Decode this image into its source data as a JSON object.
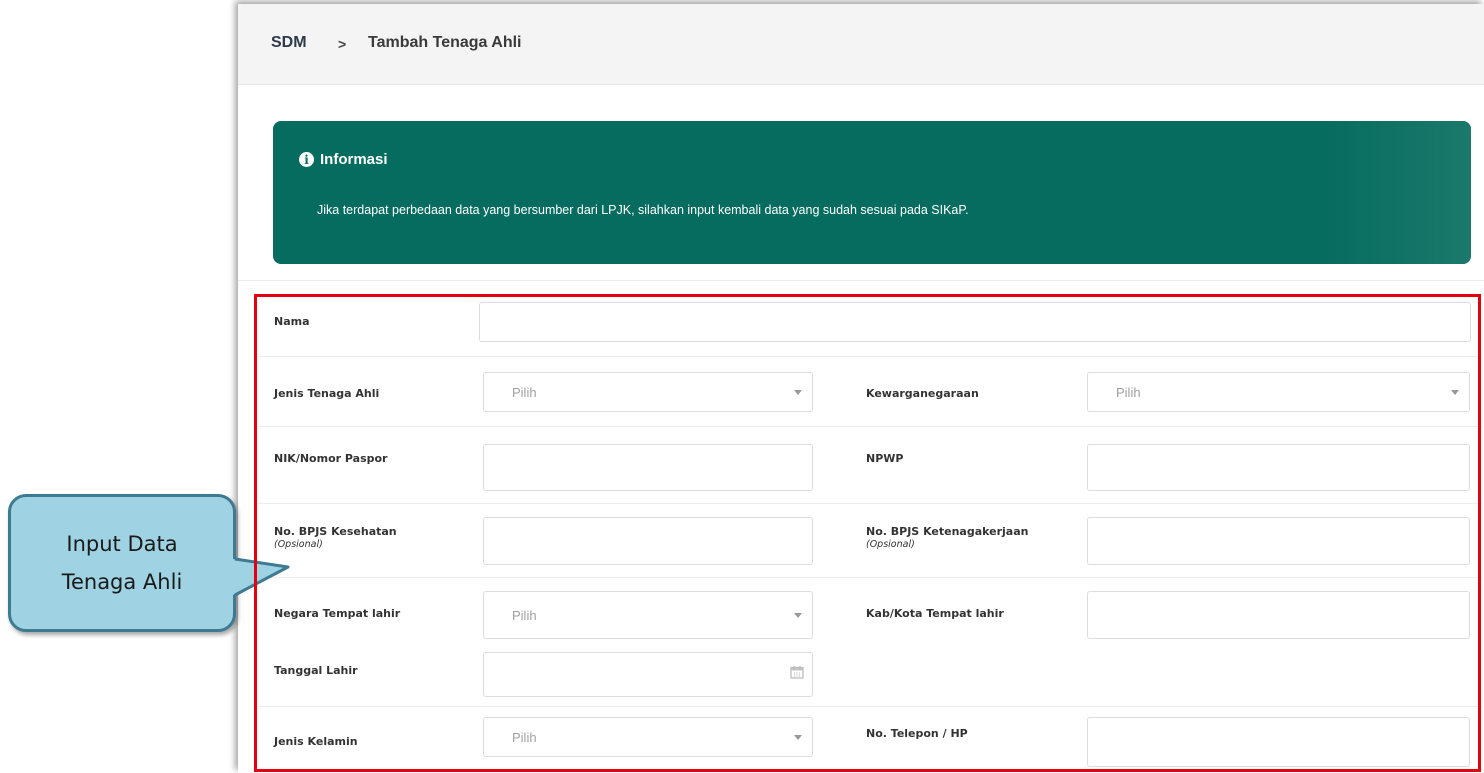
{
  "callout": {
    "line1": "Input Data",
    "line2": "Tenaga Ahli"
  },
  "breadcrumb": {
    "root": "SDM",
    "separator": ">",
    "current": "Tambah Tenaga Ahli"
  },
  "info": {
    "title": "Informasi",
    "icon": "info-icon",
    "message": "Jika terdapat perbedaan data yang bersumber dari LPJK, silahkan input kembali data yang sudah sesuai pada SIKaP."
  },
  "form": {
    "nama": {
      "label": "Nama",
      "value": ""
    },
    "jenis_tenaga_ahli": {
      "label": "Jenis Tenaga Ahli",
      "selected": "Pilih"
    },
    "kewarganegaraan": {
      "label": "Kewarganegaraan",
      "selected": "Pilih"
    },
    "nik": {
      "label": "NIK/Nomor Paspor",
      "value": ""
    },
    "npwp": {
      "label": "NPWP",
      "value": ""
    },
    "bpjs_kesehatan": {
      "label": "No. BPJS Kesehatan",
      "note": "(Opsional)",
      "value": ""
    },
    "bpjs_ketenagakerjaan": {
      "label": "No. BPJS Ketenagakerjaan",
      "note": "(Opsional)",
      "value": ""
    },
    "negara_tempat_lahir": {
      "label": "Negara Tempat lahir",
      "selected": "Pilih"
    },
    "kab_kota_tempat_lahir": {
      "label": "Kab/Kota Tempat lahir",
      "value": ""
    },
    "tanggal_lahir": {
      "label": "Tanggal Lahir",
      "value": ""
    },
    "jenis_kelamin": {
      "label": "Jenis Kelamin",
      "selected": "Pilih"
    },
    "telepon": {
      "label": "No. Telepon / HP",
      "value": ""
    }
  },
  "colors": {
    "accent_green": "#066c5f",
    "highlight_red": "#e5000f",
    "callout_fill": "#9fd3e3",
    "callout_border": "#3e7a92"
  }
}
